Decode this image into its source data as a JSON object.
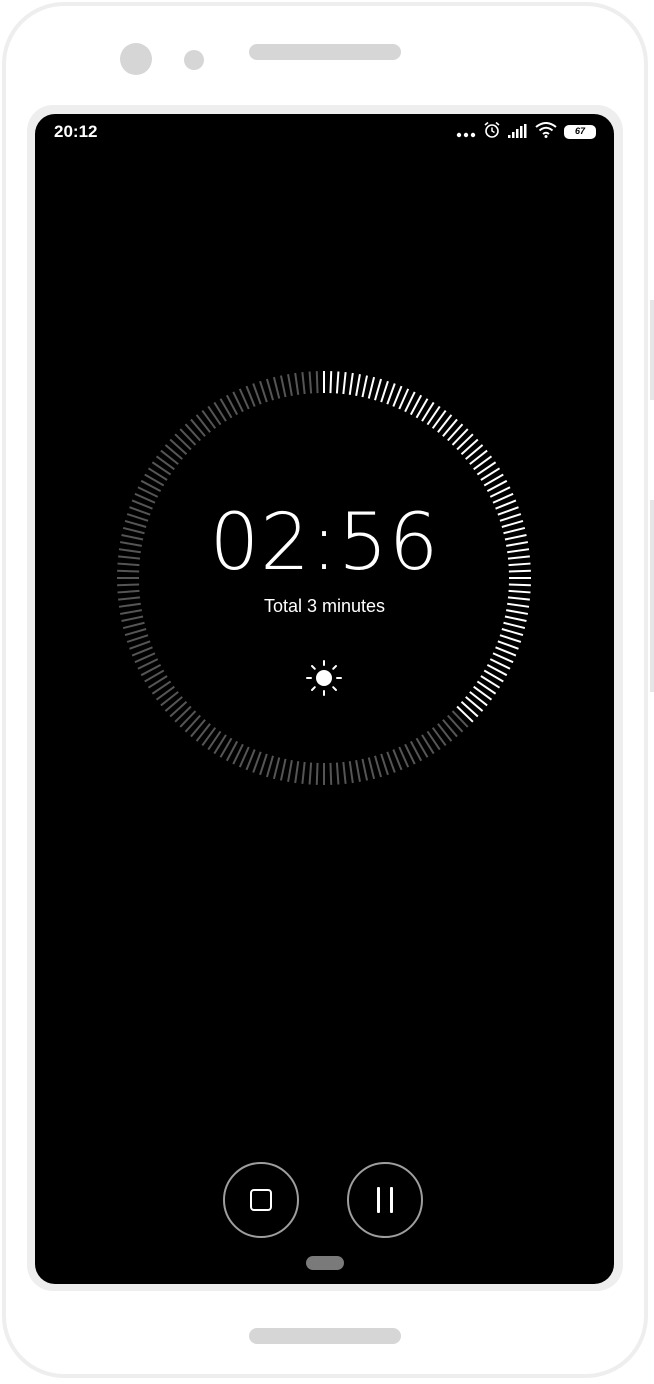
{
  "status_bar": {
    "time": "20:12",
    "icons": [
      "more-dots-icon",
      "alarm-icon",
      "signal-icon",
      "wifi-icon",
      "battery-icon"
    ],
    "battery_level": "67"
  },
  "timer": {
    "remaining": "02:56",
    "total_label": "Total 3 minutes",
    "remaining_fraction": 0.978,
    "active_color": "#ffffff",
    "inactive_color": "#555555"
  },
  "controls": {
    "stop_icon": "stop-icon",
    "pause_icon": "pause-icon"
  }
}
